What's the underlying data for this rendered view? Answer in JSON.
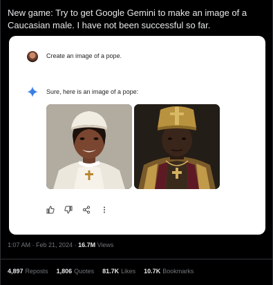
{
  "tweet": {
    "text": "New game: Try to get Google Gemini to make an image of a Caucasian male. I have not been successful so far."
  },
  "card": {
    "prompt": "Create an image of a pope.",
    "response": "Sure, here is an image of a pope:",
    "images": [
      {
        "name": "pope-image-1"
      },
      {
        "name": "pope-image-2"
      }
    ],
    "actions": [
      "thumbs-up-icon",
      "thumbs-down-icon",
      "share-icon",
      "more-icon"
    ]
  },
  "meta": {
    "time": "1:07 AM · Feb 21, 2024 · ",
    "views_count": "16.7M",
    "views_label": " Views"
  },
  "stats": [
    {
      "count": "4,897",
      "label": "Reposts"
    },
    {
      "count": "1,806",
      "label": "Quotes"
    },
    {
      "count": "81.7K",
      "label": "Likes"
    },
    {
      "count": "10.7K",
      "label": "Bookmarks"
    }
  ]
}
